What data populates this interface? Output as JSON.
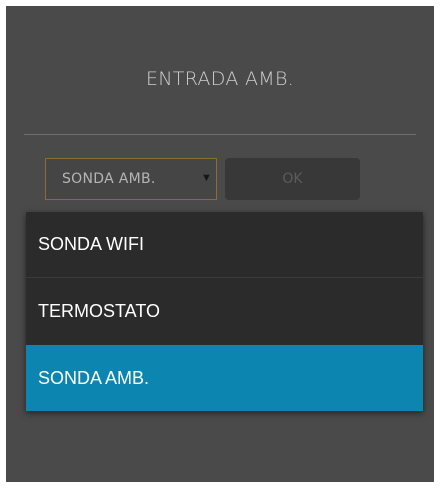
{
  "screen": {
    "title": "ENTRADA AMB."
  },
  "form": {
    "select_value": "SONDA AMB.",
    "select_arrow": "▼",
    "ok_label": "OK"
  },
  "dropdown": {
    "options": [
      {
        "label": "SONDA WIFI",
        "selected": false
      },
      {
        "label": "TERMOSTATO",
        "selected": false
      },
      {
        "label": "SONDA AMB.",
        "selected": true
      }
    ]
  },
  "colors": {
    "overlay_background": "#4a4a4a",
    "dropdown_background": "#2b2b2b",
    "selected_highlight": "#0c85b0",
    "select_border": "#8a6d2e"
  }
}
